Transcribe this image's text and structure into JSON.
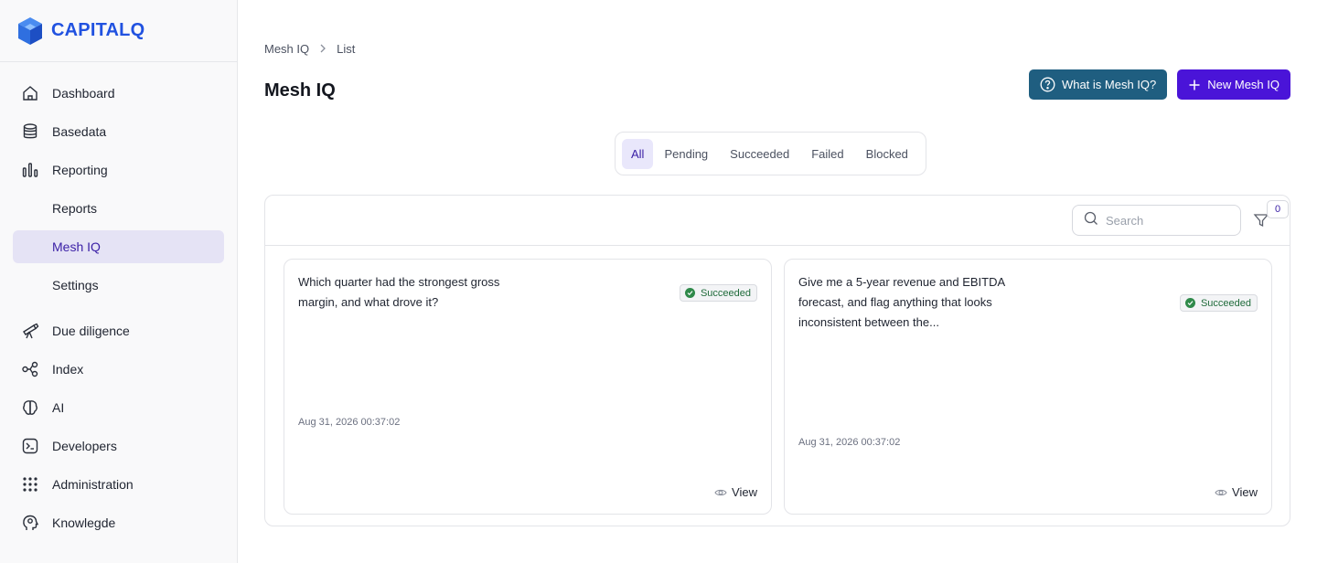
{
  "brand": {
    "name": "CAPITALQ",
    "color": "#2152e0"
  },
  "sidebar": {
    "items": [
      {
        "label": "Dashboard",
        "icon": "house-icon"
      },
      {
        "label": "Basedata",
        "icon": "database-icon"
      },
      {
        "label": "Reporting",
        "icon": "bar-chart-icon"
      },
      {
        "label": "Reports"
      },
      {
        "label": "Mesh IQ",
        "active": true
      },
      {
        "label": "Settings"
      },
      {
        "label": "Due diligence",
        "icon": "telescope-icon"
      },
      {
        "label": "Index",
        "icon": "nodes-icon"
      },
      {
        "label": "AI",
        "icon": "brain-icon"
      },
      {
        "label": "Developers",
        "icon": "terminal-icon"
      },
      {
        "label": "Administration",
        "icon": "grid-dots-icon"
      },
      {
        "label": "Knowlegde",
        "icon": "head-icon"
      }
    ]
  },
  "breadcrumb": {
    "root": "Mesh IQ",
    "current": "List"
  },
  "page": {
    "title": "Mesh IQ"
  },
  "actions": {
    "info_label": "What is Mesh IQ?",
    "new_label": "New Mesh IQ"
  },
  "tabs": [
    "All",
    "Pending",
    "Succeeded",
    "Failed",
    "Blocked"
  ],
  "active_tab": "All",
  "toolbar": {
    "search_placeholder": "Search",
    "filter_count": "0"
  },
  "cards": [
    {
      "question": "Which quarter had the strongest gross margin, and what drove it?",
      "status": "Succeeded",
      "timestamp": "Aug 31, 2026 00:37:02",
      "view_label": "View"
    },
    {
      "question": "Give me a 5-year revenue and EBITDA forecast, and flag anything that looks inconsistent between the...",
      "status": "Succeeded",
      "timestamp": "Aug 31, 2026 00:37:02",
      "view_label": "View"
    }
  ],
  "colors": {
    "accent": "#4a14d8",
    "info": "#1f5e80",
    "success": "#2f8a4a",
    "active_bg": "#e5e3f5"
  }
}
